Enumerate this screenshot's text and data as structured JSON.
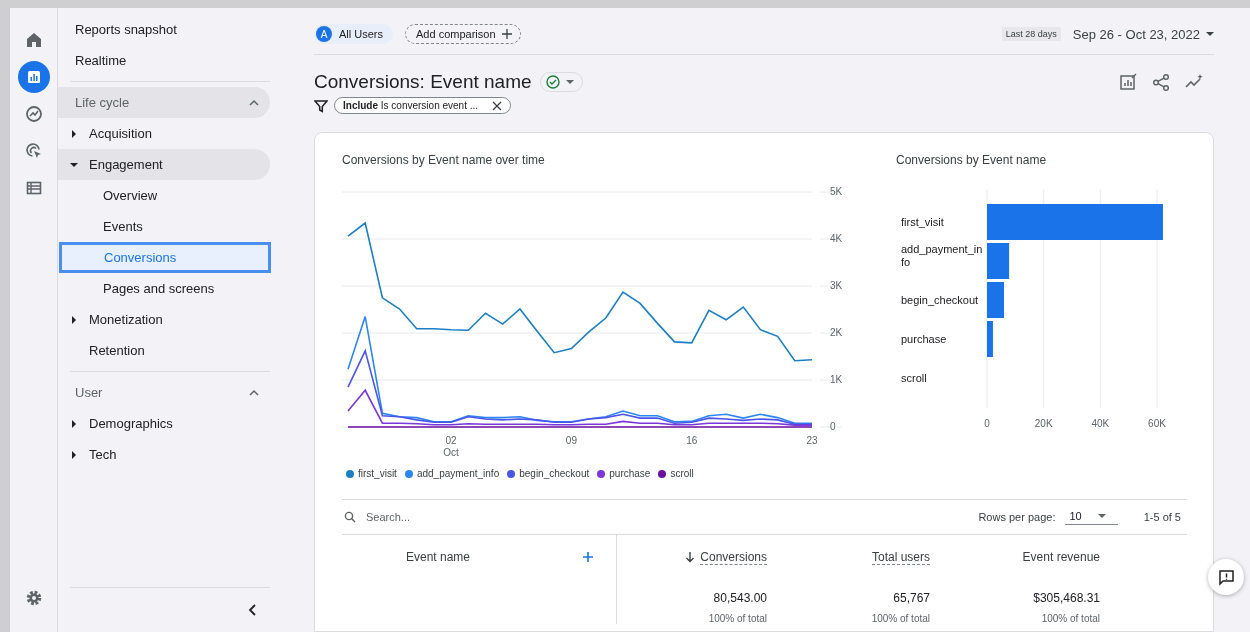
{
  "rail": [
    {
      "kind": "home",
      "selected": false
    },
    {
      "kind": "reports",
      "selected": true
    },
    {
      "kind": "explore",
      "selected": false
    },
    {
      "kind": "advertising",
      "selected": false
    },
    {
      "kind": "library",
      "selected": false
    }
  ],
  "nav": {
    "top": [
      {
        "label": "Reports snapshot",
        "selected": false
      },
      {
        "label": "Realtime",
        "selected": false
      }
    ],
    "sections": [
      {
        "label": "Life cycle",
        "expanded": true,
        "hovered": true,
        "items": [
          {
            "label": "Acquisition",
            "expandable": true,
            "expanded": false,
            "selected": false
          },
          {
            "label": "Engagement",
            "expandable": true,
            "expanded": true,
            "selected": false,
            "children": [
              {
                "label": "Overview",
                "selected": false
              },
              {
                "label": "Events",
                "selected": false
              },
              {
                "label": "Conversions",
                "selected": true
              },
              {
                "label": "Pages and screens",
                "selected": false
              }
            ]
          },
          {
            "label": "Monetization",
            "expandable": true,
            "expanded": false,
            "selected": false
          },
          {
            "label": "Retention",
            "expandable": false,
            "expanded": false,
            "selected": false
          }
        ]
      },
      {
        "label": "User",
        "expanded": true,
        "hovered": false,
        "items": [
          {
            "label": "Demographics",
            "expandable": true,
            "expanded": false,
            "selected": false
          },
          {
            "label": "Tech",
            "expandable": true,
            "expanded": false,
            "selected": false
          }
        ]
      }
    ]
  },
  "topbar": {
    "segment": {
      "badge": "A",
      "label": "All Users"
    },
    "add_comparison": "Add comparison",
    "date": {
      "preset": "Last 28 days",
      "range": "Sep 26 - Oct 23, 2022"
    }
  },
  "title": "Conversions: Event name",
  "filter": "**Include** Is conversion event ...",
  "line_chart": {
    "chart_data": {
      "type": "line",
      "title": "Conversions by Event name over time",
      "categories": [
        null,
        null,
        null,
        null,
        null,
        null,
        "02 Oct",
        null,
        null,
        null,
        null,
        null,
        null,
        "09",
        null,
        null,
        null,
        null,
        null,
        null,
        "16",
        null,
        null,
        null,
        null,
        null,
        null,
        "23"
      ],
      "ylim": [
        0,
        5000
      ],
      "grid": true,
      "yticks": [
        {
          "value": 0,
          "label": "0"
        },
        {
          "value": 1000,
          "label": "1K"
        },
        {
          "value": 2000,
          "label": "2K"
        },
        {
          "value": 3000,
          "label": "3K"
        },
        {
          "value": 4000,
          "label": "4K"
        },
        {
          "value": 5000,
          "label": "5K"
        }
      ],
      "series": [
        {
          "name": "first_visit",
          "color": "#1a7fc4",
          "values": [
            4060,
            4340,
            2750,
            2510,
            2090,
            2090,
            2070,
            2060,
            2420,
            2190,
            2510,
            2040,
            1580,
            1670,
            2020,
            2320,
            2870,
            2630,
            2210,
            1810,
            1790,
            2480,
            2280,
            2550,
            2070,
            1930,
            1410,
            1430
          ]
        },
        {
          "name": "add_payment_info",
          "color": "#2b87f0",
          "values": [
            1230,
            2350,
            290,
            220,
            200,
            110,
            110,
            240,
            200,
            200,
            220,
            140,
            110,
            110,
            170,
            220,
            340,
            240,
            240,
            110,
            120,
            240,
            270,
            190,
            270,
            200,
            80,
            80
          ]
        },
        {
          "name": "begin_checkout",
          "color": "#4a55ea",
          "values": [
            850,
            1620,
            240,
            220,
            150,
            100,
            100,
            220,
            170,
            150,
            170,
            150,
            100,
            100,
            170,
            200,
            270,
            190,
            190,
            80,
            100,
            190,
            170,
            140,
            170,
            150,
            60,
            60
          ]
        },
        {
          "name": "purchase",
          "color": "#7b36dc",
          "values": [
            340,
            780,
            80,
            80,
            70,
            50,
            50,
            70,
            60,
            60,
            60,
            60,
            50,
            50,
            60,
            60,
            120,
            80,
            80,
            50,
            50,
            80,
            80,
            80,
            80,
            70,
            40,
            40
          ]
        },
        {
          "name": "scroll",
          "color": "#6a0f9e",
          "values": [
            0,
            0,
            0,
            0,
            0,
            0,
            0,
            0,
            0,
            0,
            0,
            0,
            0,
            0,
            0,
            0,
            0,
            0,
            0,
            0,
            0,
            0,
            0,
            0,
            0,
            0,
            0,
            0
          ]
        }
      ]
    }
  },
  "bar_chart": {
    "chart_data": {
      "type": "bar",
      "orientation": "horizontal",
      "title": "Conversions by Event name",
      "categories": [
        "first_visit",
        "add_payment_info",
        "begin_checkout",
        "purchase",
        "scroll"
      ],
      "xlim": [
        0,
        62500
      ],
      "grid": true,
      "xticks": [
        {
          "value": 0,
          "label": "0"
        },
        {
          "value": 20000,
          "label": "20K"
        },
        {
          "value": 40000,
          "label": "40K"
        },
        {
          "value": 60000,
          "label": "60K"
        }
      ],
      "series": [
        {
          "color": "#1a73e8",
          "values": [
            62100,
            7800,
            6000,
            2100,
            0
          ]
        }
      ]
    }
  },
  "table": {
    "search_placeholder": "Search...",
    "rows_per_page_label": "Rows per page:",
    "rows_per_page": "10",
    "pagination": "1-5 of 5",
    "dimension": "Event name",
    "columns": [
      {
        "label": "Conversions",
        "sorted": true,
        "dotted_underline": true
      },
      {
        "label": "Total users",
        "sorted": false,
        "dotted_underline": true
      },
      {
        "label": "Event revenue",
        "sorted": false,
        "dotted_underline": false
      }
    ],
    "totals": [
      {
        "value": "80,543.00",
        "share": "100% of total"
      },
      {
        "value": "65,767",
        "share": "100% of total"
      },
      {
        "value": "$305,468.31",
        "share": "100% of total"
      }
    ]
  }
}
